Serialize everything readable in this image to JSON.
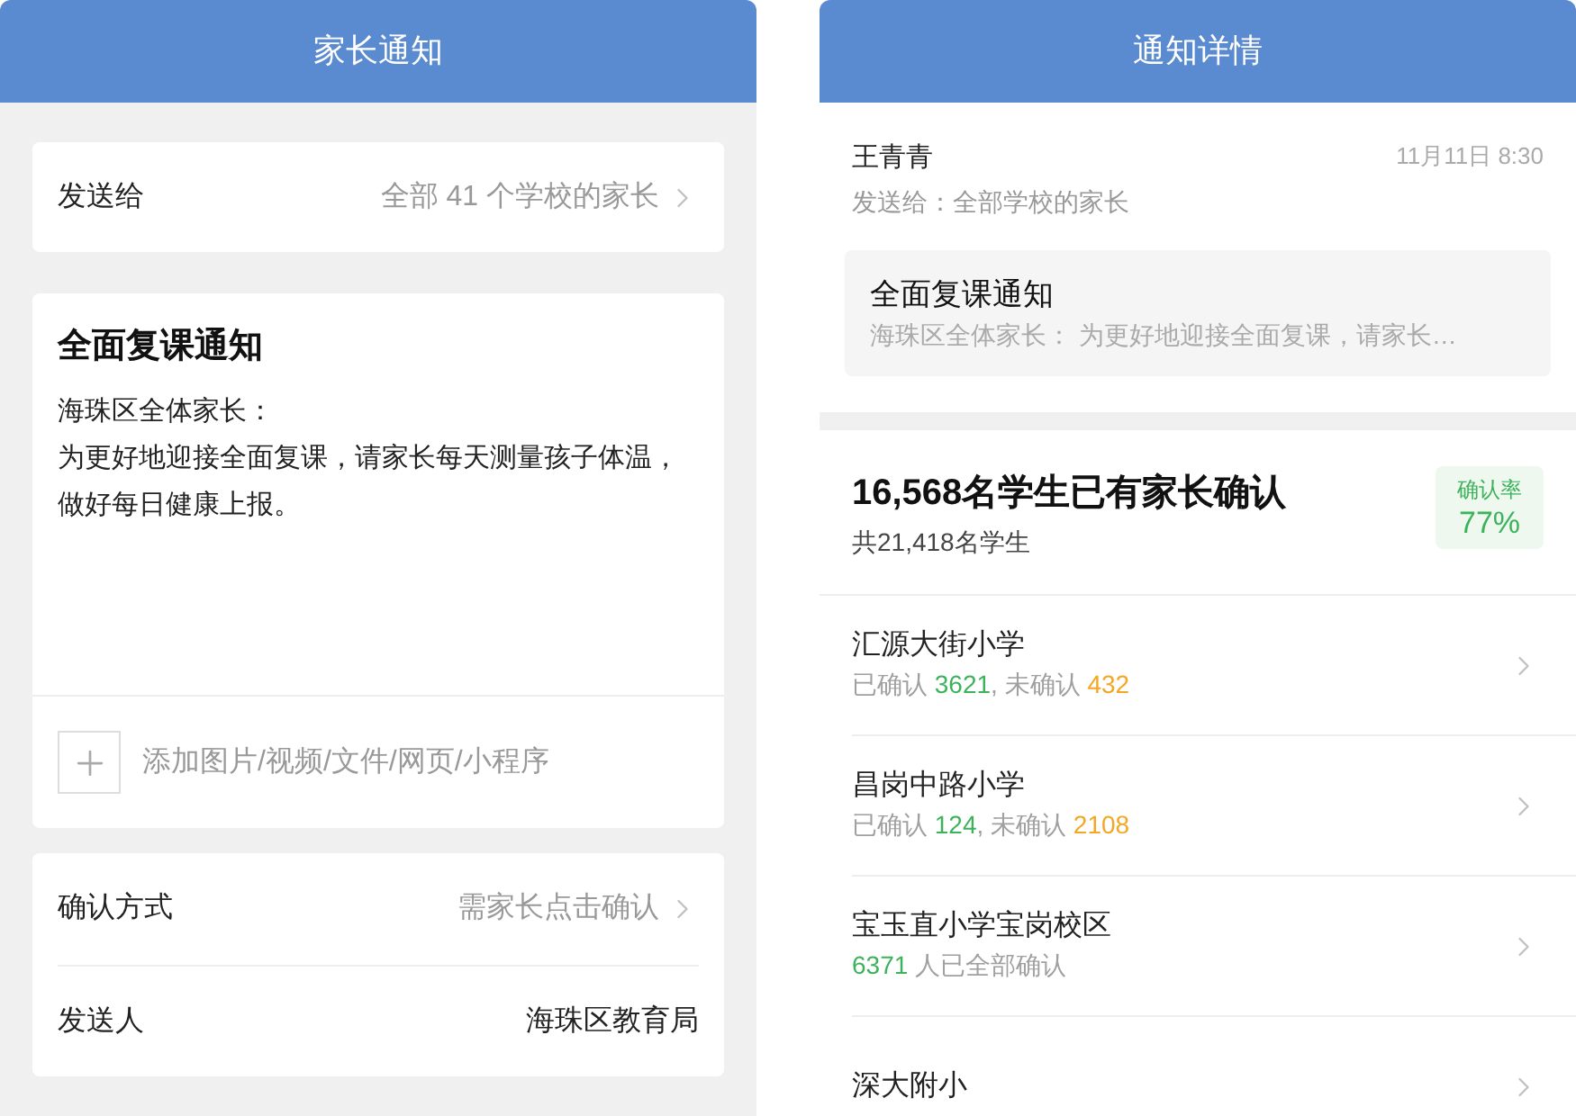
{
  "compose": {
    "title": "家长通知",
    "send_to": {
      "label": "发送给",
      "value": "全部 41 个学校的家长"
    },
    "notice": {
      "title": "全面复课通知",
      "body_lines": [
        "海珠区全体家长：",
        "为更好地迎接全面复课，请家长每天测量孩子体温，做好每日健康上报。"
      ]
    },
    "attach": {
      "placeholder": "添加图片/视频/文件/网页/小程序"
    },
    "settings": [
      {
        "label": "确认方式",
        "value": "需家长点击确认",
        "kind": "link"
      },
      {
        "label": "发送人",
        "value": "海珠区教育局",
        "kind": "plain"
      }
    ]
  },
  "detail": {
    "title": "通知详情",
    "sender": "王青青",
    "time": "11月11日 8:30",
    "recipients": "发送给：全部学校的家长",
    "preview": {
      "title": "全面复课通知",
      "excerpt": "海珠区全体家长： 为更好地迎接全面复课，请家长…"
    },
    "summary": {
      "headline": "16,568名学生已有家长确认",
      "total": "共21,418名学生",
      "rate_label": "确认率",
      "rate": "77%"
    },
    "schools": [
      {
        "name": "汇源大街小学",
        "status": [
          {
            "text": "已确认 ",
            "kind": "muted"
          },
          {
            "text": "3621",
            "kind": "confirmed"
          },
          {
            "text": ", 未确认 ",
            "kind": "muted"
          },
          {
            "text": "432",
            "kind": "pending"
          }
        ]
      },
      {
        "name": "昌岗中路小学",
        "status": [
          {
            "text": "已确认 ",
            "kind": "muted"
          },
          {
            "text": "124",
            "kind": "confirmed"
          },
          {
            "text": ", 未确认 ",
            "kind": "muted"
          },
          {
            "text": "2108",
            "kind": "pending"
          }
        ]
      },
      {
        "name": "宝玉直小学宝岗校区",
        "status": [
          {
            "text": "6371",
            "kind": "confirmed"
          },
          {
            "text": " 人已全部确认",
            "kind": "muted"
          }
        ]
      },
      {
        "name": "深大附小"
      }
    ]
  }
}
